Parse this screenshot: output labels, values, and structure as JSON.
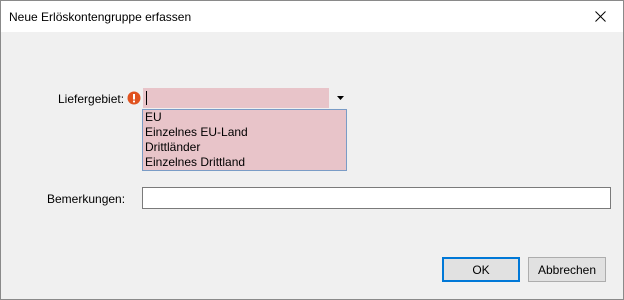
{
  "window": {
    "title": "Neue Erlöskontengruppe erfassen"
  },
  "icons": {
    "close": "close-icon",
    "warning": "error-icon",
    "dropdown_arrow": "chevron-down-icon"
  },
  "form": {
    "liefergebiet_label": "Liefergebiet:",
    "liefergebiet_value": "",
    "liefergebiet_options": [
      "EU",
      "Einzelnes EU-Land",
      "Drittländer",
      "Einzelnes Drittland"
    ],
    "bemerkungen_label": "Bemerkungen:",
    "bemerkungen_value": ""
  },
  "buttons": {
    "ok": "OK",
    "cancel": "Abbrechen"
  },
  "colors": {
    "error_field_background": "#e8c4c9",
    "warning_icon": "#e0521f",
    "focus_border": "#0078d7"
  }
}
